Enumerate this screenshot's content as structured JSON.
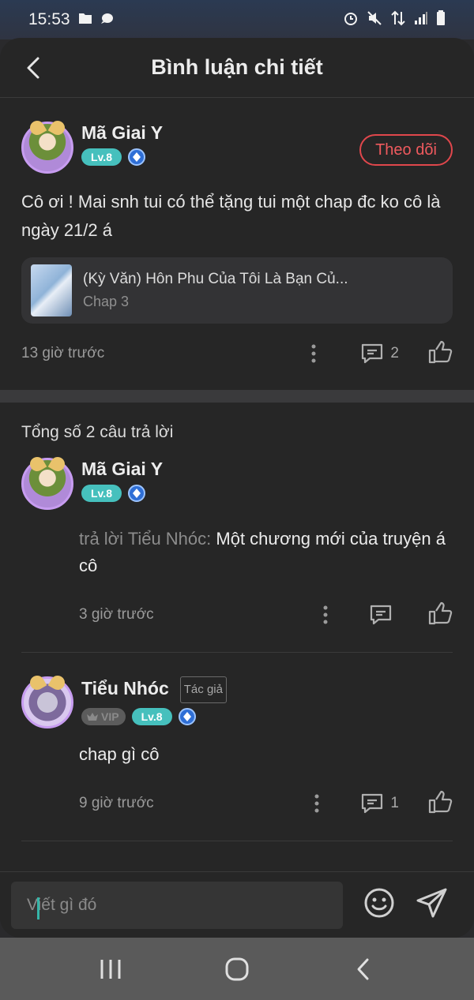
{
  "status_bar": {
    "time": "15:53"
  },
  "header": {
    "title": "Bình luận chi tiết"
  },
  "main_comment": {
    "user_name": "Mã Giai Y",
    "level": "Lv.8",
    "follow_label": "Theo dõi",
    "text": "Cô ơi ! Mai snh tui có thể tặng tui một chap đc ko cô là ngày 21/2 á",
    "book": {
      "title": "(Kỳ Văn) Hôn Phu Của Tôi Là Bạn Củ...",
      "chapter": "Chap 3"
    },
    "time": "13 giờ trước",
    "reply_count": "2"
  },
  "replies": {
    "total": "Tổng số 2 câu trả lời",
    "items": [
      {
        "user_name": "Mã Giai Y",
        "level": "Lv.8",
        "prefix": "trả lời Tiểu Nhóc: ",
        "text": "Một chương mới của truyện á cô",
        "time": "3 giờ trước",
        "reply_count": ""
      },
      {
        "user_name": "Tiểu Nhóc",
        "author_tag": "Tác giả",
        "vip": "VIP",
        "level": "Lv.8",
        "text": "chap gì cô",
        "time": "9 giờ trước",
        "reply_count": "1"
      }
    ]
  },
  "composer": {
    "placeholder": "Viết gì đó"
  },
  "colors": {
    "accent_red": "#e0474c",
    "level_teal": "#46c0bd",
    "background": "#262626"
  }
}
